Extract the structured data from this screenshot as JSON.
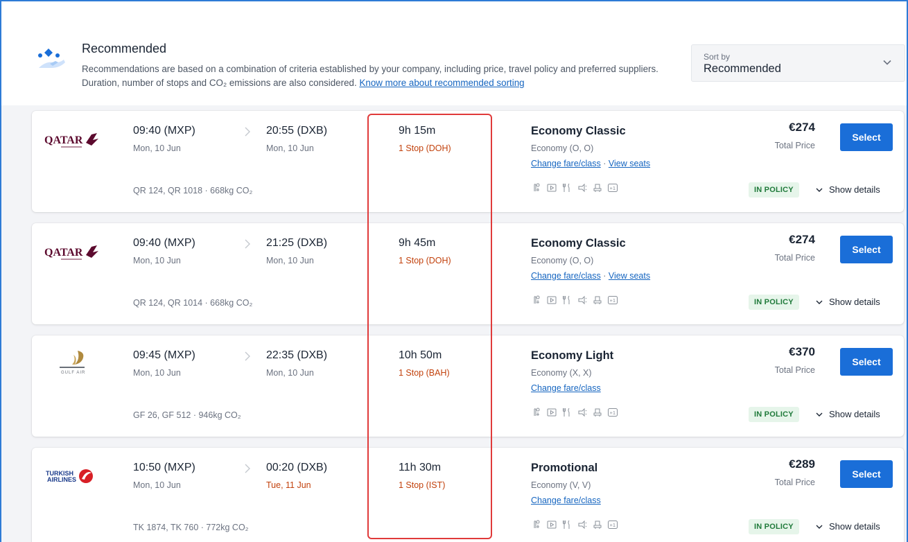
{
  "header": {
    "title": "Recommended",
    "description": "Recommendations are based on a combination of criteria established by your company, including price, travel policy and preferred suppliers. Duration, number of stops and CO₂ emissions are also considered.",
    "link_label": "Know more about recommended sorting"
  },
  "sort": {
    "label": "Sort by",
    "value": "Recommended"
  },
  "colors": {
    "primary": "#1a6ed8",
    "alert": "#c2410c",
    "policy_bg": "#e6f5ea",
    "policy_text": "#1f7a3a",
    "highlight": "#e03a3a"
  },
  "results": [
    {
      "airline": "QATAR",
      "dep_time": "09:40 (MXP)",
      "dep_date": "Mon, 10 Jun",
      "arr_time": "20:55 (DXB)",
      "arr_date": "Mon, 10 Jun",
      "duration": "9h 15m",
      "stops": "1 Stop (DOH)",
      "flights": "QR 124, QR 1018 · 668kg CO₂",
      "fare": "Economy Classic",
      "fare_sub": "Economy (O, O)",
      "change_fare": "Change fare/class",
      "view_seats": "View seats",
      "price": "€274",
      "price_sub": "Total Price",
      "select": "Select",
      "policy": "IN POLICY",
      "details": "Show details"
    },
    {
      "airline": "QATAR",
      "dep_time": "09:40 (MXP)",
      "dep_date": "Mon, 10 Jun",
      "arr_time": "21:25 (DXB)",
      "arr_date": "Mon, 10 Jun",
      "duration": "9h 45m",
      "stops": "1 Stop (DOH)",
      "flights": "QR 124, QR 1014 · 668kg CO₂",
      "fare": "Economy Classic",
      "fare_sub": "Economy (O, O)",
      "change_fare": "Change fare/class",
      "view_seats": "View seats",
      "price": "€274",
      "price_sub": "Total Price",
      "select": "Select",
      "policy": "IN POLICY",
      "details": "Show details"
    },
    {
      "airline": "GULF AIR",
      "dep_time": "09:45 (MXP)",
      "dep_date": "Mon, 10 Jun",
      "arr_time": "22:35 (DXB)",
      "arr_date": "Mon, 10 Jun",
      "duration": "10h 50m",
      "stops": "1 Stop (BAH)",
      "flights": "GF 26, GF 512 · 946kg CO₂",
      "fare": "Economy Light",
      "fare_sub": "Economy (X, X)",
      "change_fare": "Change fare/class",
      "price": "€370",
      "price_sub": "Total Price",
      "select": "Select",
      "policy": "IN POLICY",
      "details": "Show details"
    },
    {
      "airline": "TURKISH AIRLINES",
      "dep_time": "10:50 (MXP)",
      "dep_date": "Mon, 10 Jun",
      "arr_time": "00:20 (DXB)",
      "arr_date": "Tue, 11 Jun",
      "duration": "11h 30m",
      "stops": "1 Stop (IST)",
      "flights": "TK 1874, TK 760 · 772kg CO₂",
      "fare": "Promotional",
      "fare_sub": "Economy (V, V)",
      "change_fare": "Change fare/class",
      "price": "€289",
      "price_sub": "Total Price",
      "select": "Select",
      "policy": "IN POLICY",
      "details": "Show details"
    }
  ]
}
